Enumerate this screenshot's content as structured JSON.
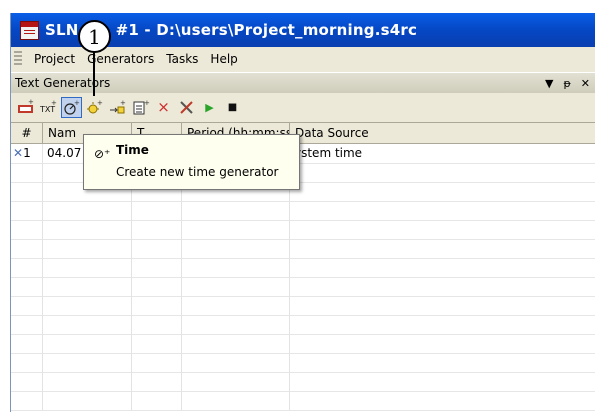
{
  "window": {
    "title": "SLN       me #1  - D:\\users\\Project_morning.s4rc"
  },
  "menubar": {
    "items": [
      "Project",
      "Generators",
      "Tasks",
      "Help"
    ]
  },
  "panel": {
    "title": "Text Generators",
    "controls": {
      "dropdown": "▼",
      "pin": "ᵽ",
      "close": "✕"
    }
  },
  "toolbar": {
    "buttons": [
      {
        "name": "tsb-generator-icon"
      },
      {
        "name": "text-generator-icon",
        "glyph": "TXT"
      },
      {
        "name": "time-generator-icon",
        "glyph": "⊘"
      },
      {
        "name": "light-generator-icon"
      },
      {
        "name": "import-generator-icon"
      },
      {
        "name": "list-generator-icon"
      },
      {
        "name": "delete-icon",
        "glyph": "×"
      },
      {
        "name": "tools-icon"
      },
      {
        "name": "play-icon",
        "glyph": "▶"
      },
      {
        "name": "stop-icon",
        "glyph": "■"
      }
    ]
  },
  "grid": {
    "columns": [
      "#",
      "Nam",
      "T",
      "Period (hh:mm:ss)",
      "Data Source"
    ],
    "rows": [
      {
        "num": "1",
        "name": "04.07",
        "source": "ystem time"
      }
    ]
  },
  "tooltip": {
    "icon": "⊘⁺",
    "title": "Time",
    "description": "Create new time generator"
  },
  "callout": {
    "number": "1"
  },
  "colors": {
    "titlebar": "#0547c4",
    "toolbar_active": "#c1d2ee",
    "play_green": "#2aa52a",
    "delete_red": "#d02a2a"
  }
}
